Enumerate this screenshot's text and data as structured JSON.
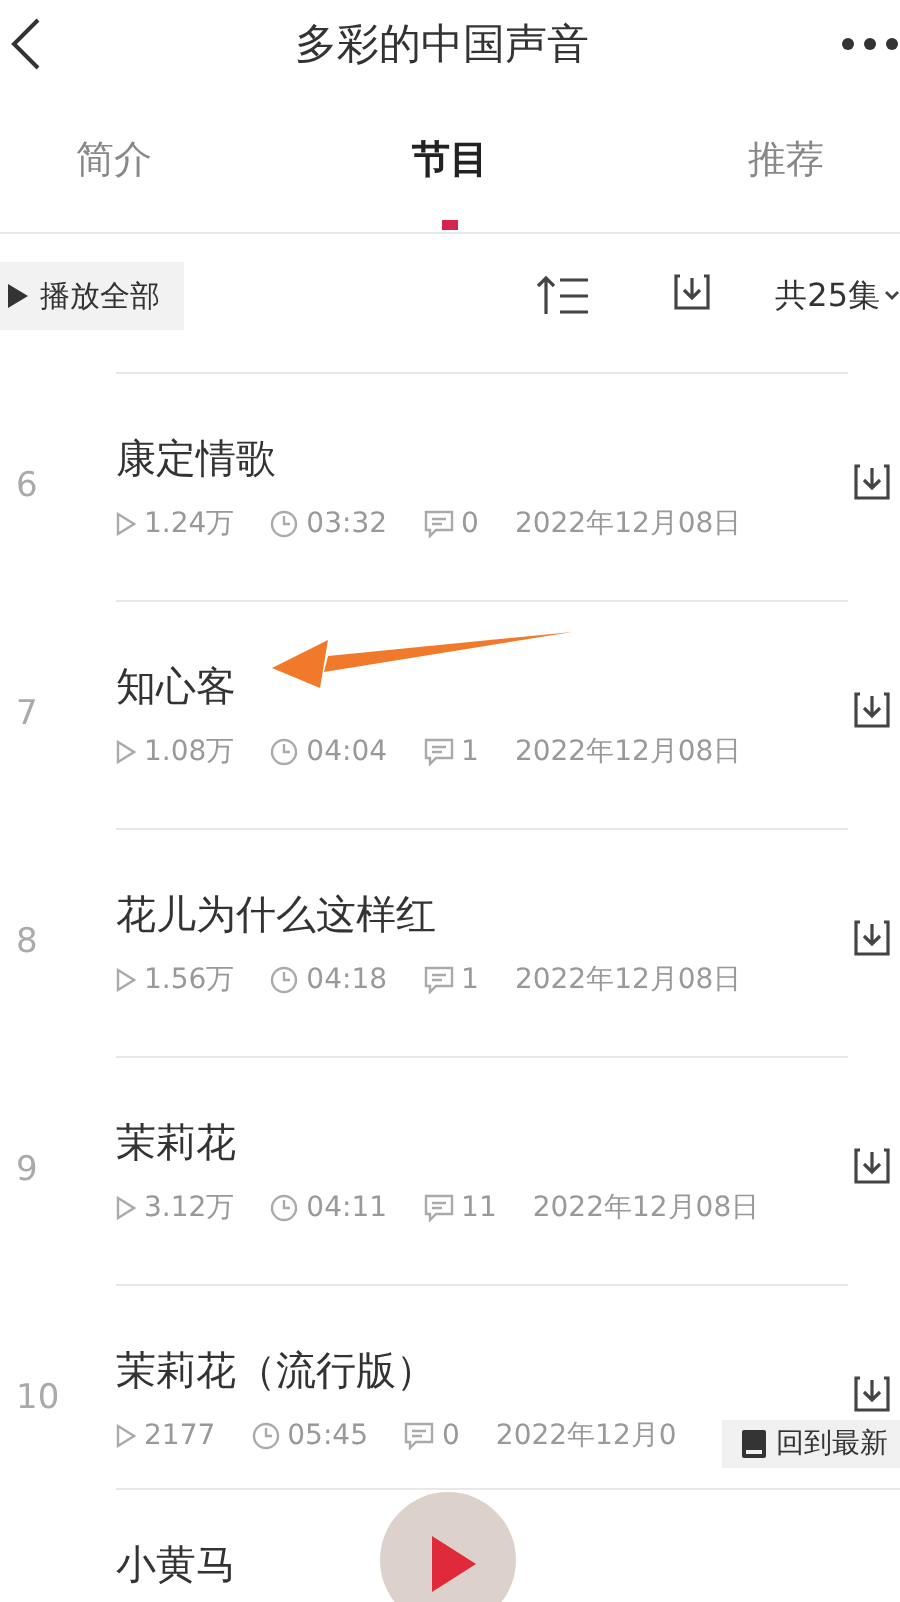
{
  "header": {
    "title": "多彩的中国声音"
  },
  "tabs": [
    {
      "label": "简介",
      "selected": false
    },
    {
      "label": "节目",
      "selected": true
    },
    {
      "label": "推荐",
      "selected": false
    }
  ],
  "toolbar": {
    "play_all": "播放全部",
    "count": "共25集"
  },
  "episodes": [
    {
      "number": "6",
      "title": "康定情歌",
      "plays": "1.24万",
      "duration": "03:32",
      "comments": "0",
      "date": "2022年12月08日"
    },
    {
      "number": "7",
      "title": "知心客",
      "plays": "1.08万",
      "duration": "04:04",
      "comments": "1",
      "date": "2022年12月08日"
    },
    {
      "number": "8",
      "title": "花儿为什么这样红",
      "plays": "1.56万",
      "duration": "04:18",
      "comments": "1",
      "date": "2022年12月08日"
    },
    {
      "number": "9",
      "title": "茉莉花",
      "plays": "3.12万",
      "duration": "04:11",
      "comments": "11",
      "date": "2022年12月08日"
    },
    {
      "number": "10",
      "title": "茉莉花（流行版）",
      "plays": "2177",
      "duration": "05:45",
      "comments": "0",
      "date": "2022年12月0"
    },
    {
      "title": "小黄马"
    }
  ],
  "back_to_latest": "回到最新"
}
